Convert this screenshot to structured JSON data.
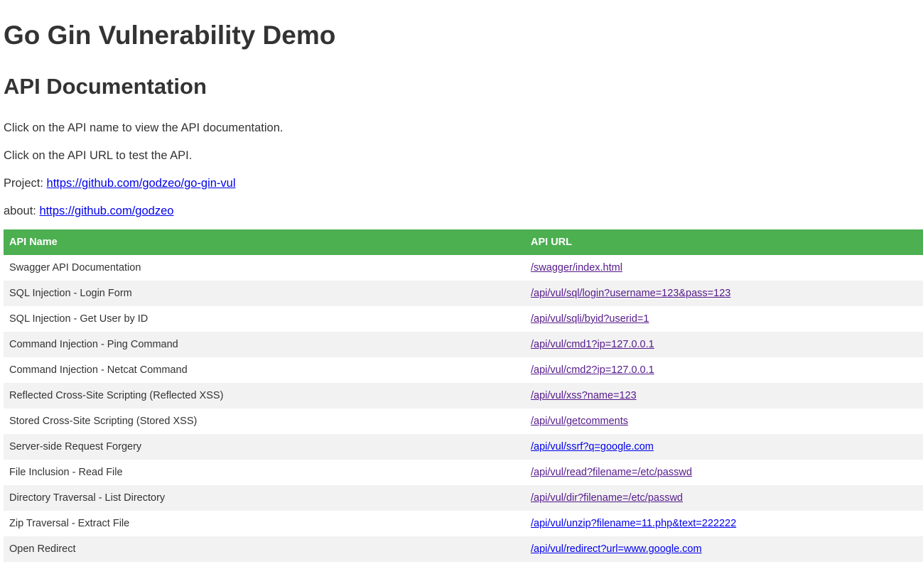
{
  "page": {
    "title": "Go Gin Vulnerability Demo",
    "subtitle": "API Documentation",
    "intro_1": "Click on the API name to view the API documentation.",
    "intro_2": "Click on the API URL to test the API.",
    "project_label": "Project: ",
    "project_link": "https://github.com/godzeo/go-gin-vul",
    "about_label": "about: ",
    "about_link": "https://github.com/godzeo"
  },
  "table": {
    "headers": [
      "API Name",
      "API URL"
    ],
    "header_color": "#4caf50",
    "rows": [
      {
        "name": "Swagger API Documentation",
        "url": "/swagger/index.html",
        "visited": true
      },
      {
        "name": "SQL Injection - Login Form",
        "url": "/api/vul/sql/login?username=123&pass=123",
        "visited": true
      },
      {
        "name": "SQL Injection - Get User by ID",
        "url": "/api/vul/sqli/byid?userid=1",
        "visited": true
      },
      {
        "name": "Command Injection - Ping Command",
        "url": "/api/vul/cmd1?ip=127.0.0.1",
        "visited": true
      },
      {
        "name": "Command Injection - Netcat Command",
        "url": "/api/vul/cmd2?ip=127.0.0.1",
        "visited": true
      },
      {
        "name": "Reflected Cross-Site Scripting (Reflected XSS)",
        "url": "/api/vul/xss?name=123",
        "visited": true
      },
      {
        "name": "Stored Cross-Site Scripting (Stored XSS)",
        "url": "/api/vul/getcomments",
        "visited": true
      },
      {
        "name": "Server-side Request Forgery",
        "url": "/api/vul/ssrf?q=google.com",
        "visited": false
      },
      {
        "name": "File Inclusion - Read File",
        "url": "/api/vul/read?filename=/etc/passwd",
        "visited": true
      },
      {
        "name": "Directory Traversal - List Directory",
        "url": "/api/vul/dir?filename=/etc/passwd",
        "visited": true
      },
      {
        "name": "Zip Traversal - Extract File",
        "url": "/api/vul/unzip?filename=11.php&text=222222",
        "visited": false
      },
      {
        "name": "Open Redirect",
        "url": "/api/vul/redirect?url=www.google.com",
        "visited": false
      }
    ]
  }
}
